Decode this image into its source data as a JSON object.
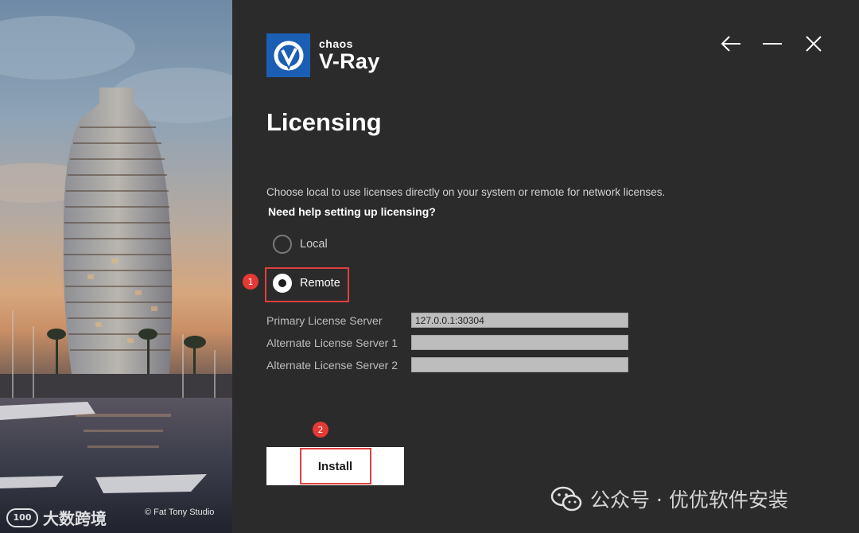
{
  "photo": {
    "credit": "© Fat Tony Studio"
  },
  "watermark_left": {
    "logo_text": "100",
    "text": "大数跨境"
  },
  "logo": {
    "brand": "chaos",
    "product": "V-Ray"
  },
  "window_controls": {
    "back_icon": "arrow-left-icon",
    "minimize_icon": "minimize-icon",
    "close_icon": "close-icon"
  },
  "title": "Licensing",
  "description": "Choose local to use licenses directly on your system or remote for network licenses.",
  "help_link": "Need help setting up licensing?",
  "license_mode": {
    "options": [
      {
        "label": "Local",
        "checked": false
      },
      {
        "label": "Remote",
        "checked": true
      }
    ]
  },
  "servers": [
    {
      "label": "Primary License Server",
      "value": "127.0.0.1:30304"
    },
    {
      "label": "Alternate License Server 1",
      "value": ""
    },
    {
      "label": "Alternate License Server 2",
      "value": ""
    }
  ],
  "install_label": "Install",
  "annotations": {
    "step1": "1",
    "step2": "2"
  },
  "watermark_right": {
    "text": "公众号 · 优优软件安装"
  },
  "colors": {
    "accent": "#1b5fb4",
    "highlight": "#e0403e",
    "badge": "#e53935",
    "background": "#2b2b2b"
  }
}
